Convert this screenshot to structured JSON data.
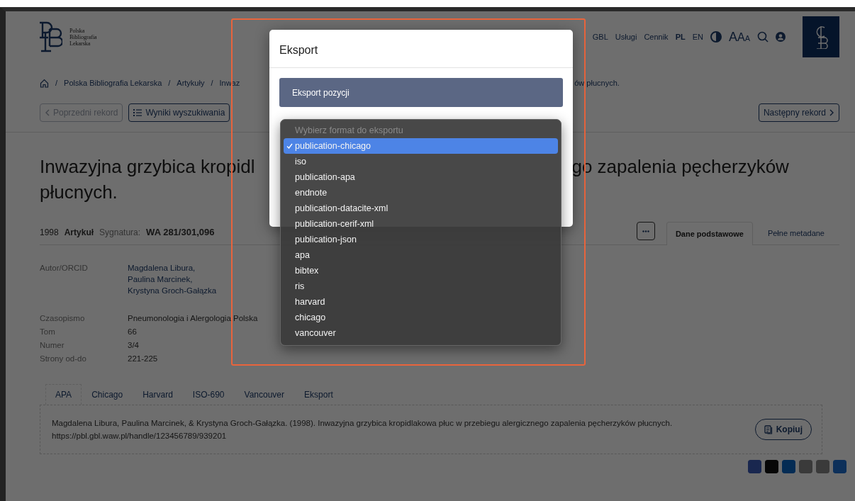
{
  "header": {
    "logo_text": [
      "Polska",
      "Bibliografia",
      "Lekarska"
    ],
    "nav": [
      {
        "label": "GBL"
      },
      {
        "label": "Usługi"
      },
      {
        "label": "Cennik"
      }
    ],
    "languages": [
      {
        "label": "PL",
        "selected": true
      },
      {
        "label": "EN",
        "selected": false
      }
    ],
    "font_size_letters": [
      "A",
      "A",
      "A"
    ]
  },
  "breadcrumb": {
    "separator": "/",
    "items": [
      "Polska Bibliografia Lekarska",
      "Artykuły",
      "Inwaz"
    ],
    "tail": "ów płucnych."
  },
  "record_nav": {
    "previous": {
      "label": "Poprzedni rekord",
      "disabled": true
    },
    "results": "Wyniki wyszukiwania",
    "next": "Następny rekord"
  },
  "title": {
    "line_1": [
      "Inwazyjna grzybica kropidl",
      "go zapalenia pęcherzyków"
    ],
    "line_2": "płucnych."
  },
  "summary": {
    "year": "1998",
    "type": "Artykuł",
    "signature_label": "Sygnatura:",
    "signature": "WA 281/301,096"
  },
  "view_tabs": [
    {
      "label": "Dane podstawowe",
      "selected": true
    },
    {
      "label": "Pełne metadane",
      "selected": false
    }
  ],
  "metadata": [
    {
      "label": "Autor/ORCID",
      "kind": "links",
      "values": [
        "Magdalena Libura,",
        "Paulina Marcinek,",
        "Krystyna Groch-Gałązka"
      ]
    },
    {
      "label": "Czasopismo",
      "kind": "text",
      "values": [
        "Pneumonologia i Alergologia Polska"
      ]
    },
    {
      "label": "Tom",
      "kind": "text",
      "values": [
        "66"
      ]
    },
    {
      "label": "Numer",
      "kind": "text",
      "values": [
        "3/4"
      ]
    },
    {
      "label": "Strony od-do",
      "kind": "text",
      "values": [
        "221-225"
      ]
    }
  ],
  "citation_tabs": [
    {
      "label": "APA",
      "selected": true
    },
    {
      "label": "Chicago",
      "selected": false
    },
    {
      "label": "Harvard",
      "selected": false
    },
    {
      "label": "ISO-690",
      "selected": false
    },
    {
      "label": "Vancouver",
      "selected": false
    },
    {
      "label": "Eksport",
      "selected": false
    }
  ],
  "citation": {
    "text": "Magdalena Libura, Paulina Marcinek, & Krystyna Groch-Gałązka. (1998). Inwazyjna grzybica kropidlakowa płuc w przebiegu alergicznego zapalenia pęcherzyków płucnych.",
    "url": "https://pbl.gbl.waw.pl/handle/123456789/939201"
  },
  "copy_button": "Kopiuj",
  "modal": {
    "title": "Eksport",
    "section": "Eksport pozycji"
  },
  "format_menu": {
    "prompt": "Wybierz format do eksportu",
    "options": [
      {
        "label": "publication-chicago",
        "selected": true
      },
      {
        "label": "iso",
        "selected": false
      },
      {
        "label": "publication-apa",
        "selected": false
      },
      {
        "label": "endnote",
        "selected": false
      },
      {
        "label": "publication-datacite-xml",
        "selected": false
      },
      {
        "label": "publication-cerif-xml",
        "selected": false
      },
      {
        "label": "publication-json",
        "selected": false
      },
      {
        "label": "apa",
        "selected": false
      },
      {
        "label": "bibtex",
        "selected": false
      },
      {
        "label": "ris",
        "selected": false
      },
      {
        "label": "harvard",
        "selected": false
      },
      {
        "label": "chicago",
        "selected": false
      },
      {
        "label": "vancouver",
        "selected": false
      }
    ]
  }
}
